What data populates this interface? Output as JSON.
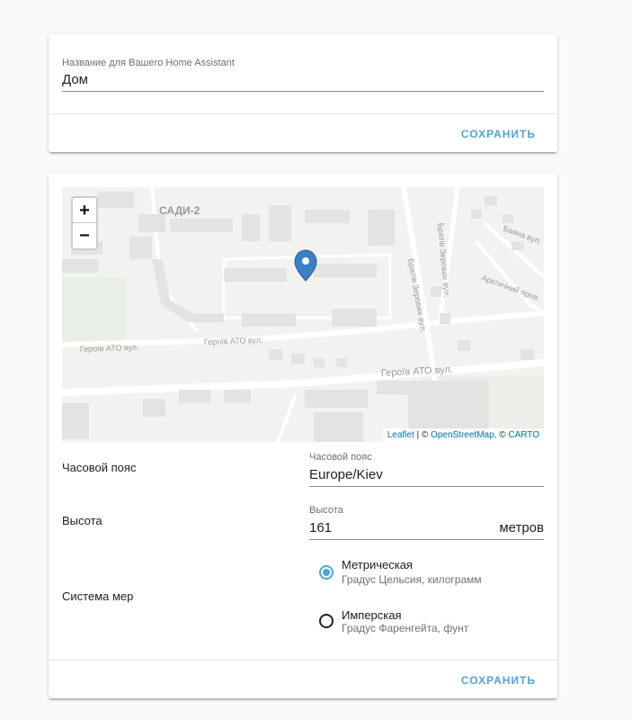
{
  "general_card": {
    "name_label": "Название для Вашего Home Assistant",
    "name_value": "Дом",
    "save_label": "СОХРАНИТЬ"
  },
  "location_card": {
    "map": {
      "zoom_in": "+",
      "zoom_out": "−",
      "attribution_leaflet": "Leaflet",
      "attribution_sep1": " | © ",
      "attribution_osm": "OpenStreetMap",
      "attribution_sep2": ", © ",
      "attribution_carto": "CARTO",
      "labels": {
        "district": "САДИ-2",
        "street_geroiv_small_1": "Героїв АТО вул.",
        "street_geroiv_small_2": "Героїв АТО вул.",
        "street_geroiv_main": "Героїв АТО вул.",
        "street_bratyv_1": "Братів Зерових вул.",
        "street_bratyv_2": "Братів Зерових вул.",
        "street_bayana": "Баяна вул.",
        "street_arktychnyi": "Арктичний пров."
      },
      "marker_icon": "map-marker-icon",
      "marker_color": "#3b7fc4"
    },
    "timezone": {
      "row_label": "Часовой пояс",
      "field_label": "Часовой пояс",
      "value": "Europe/Kiev"
    },
    "elevation": {
      "row_label": "Высота",
      "field_label": "Высота",
      "value": "161",
      "suffix": "метров"
    },
    "unit_system": {
      "row_label": "Система мер",
      "options": [
        {
          "title": "Метрическая",
          "subtitle": "Градус Цельсия, килограмм",
          "checked": true
        },
        {
          "title": "Имперская",
          "subtitle": "Градус Фаренгейта, фунт",
          "checked": false
        }
      ]
    },
    "save_label": "СОХРАНИТЬ"
  },
  "colors": {
    "accent": "#4fa3e0",
    "background": "#fafafa"
  }
}
